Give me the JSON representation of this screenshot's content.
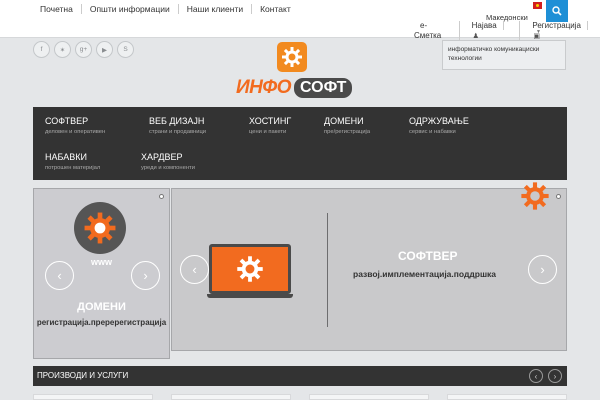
{
  "topnav": {
    "items": [
      "Почетна",
      "Општи информации",
      "Наши клиенти",
      "Контакт"
    ]
  },
  "language": {
    "selected": "Македонски",
    "flag_icon": "macedonia-flag-icon"
  },
  "account": {
    "ecard": "е-Сметка",
    "login": "Најава",
    "register": "Регистрација"
  },
  "social": [
    "facebook-icon",
    "twitter-icon",
    "google-plus-icon",
    "youtube-icon",
    "skype-icon"
  ],
  "logo": {
    "part1": "ИНФО",
    "part2": "СОФТ"
  },
  "header_box": {
    "text": "информатичко комуникациски технологии"
  },
  "menu": {
    "items": [
      {
        "title": "СОФТВЕР",
        "sub": "деловен и оперативен"
      },
      {
        "title": "ВЕБ ДИЗАЈН",
        "sub": "страни и продавници"
      },
      {
        "title": "ХОСТИНГ",
        "sub": "цени и пакети"
      },
      {
        "title": "ДОМЕНИ",
        "sub": "пре/регистрација"
      },
      {
        "title": "ОДРЖУВАЊЕ",
        "sub": "сервис и набавки"
      },
      {
        "title": "НАБАВКИ",
        "sub": "потрошен материјал"
      },
      {
        "title": "ХАРДВЕР",
        "sub": "уреди и компоненти"
      }
    ]
  },
  "slider_left": {
    "badge": "www",
    "title": "ДОМЕНИ",
    "subtitle": "регистрација.преререгистрација"
  },
  "slider_main": {
    "title": "СОФТВЕР",
    "subtitle": "развој.имплементација.поддршка"
  },
  "products": {
    "title": "ПРОИЗВОДИ И УСЛУГИ"
  },
  "colors": {
    "accent": "#1e8fd6",
    "brand_orange": "#f26b1f",
    "menu_bg": "#333333"
  }
}
